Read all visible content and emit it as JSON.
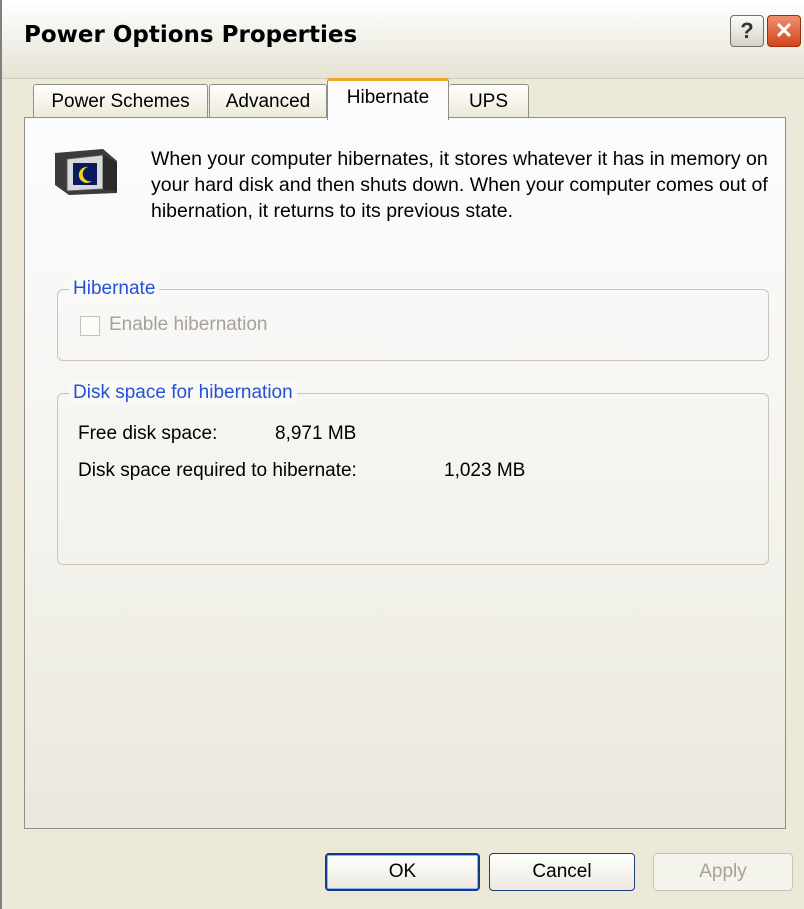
{
  "window": {
    "title": "Power Options Properties",
    "help_label": "?",
    "close_label": "✕"
  },
  "tabs": [
    {
      "label": "Power Schemes",
      "active": false
    },
    {
      "label": "Advanced",
      "active": false
    },
    {
      "label": "Hibernate",
      "active": true
    },
    {
      "label": "UPS",
      "active": false
    }
  ],
  "hibernate_tab": {
    "description": "When your computer hibernates, it stores whatever it has in memory on your hard disk and then shuts down. When your computer comes out of hibernation, it returns to its previous state.",
    "hibernate_group": {
      "legend": "Hibernate",
      "checkbox_label": "Enable hibernation",
      "checked": false,
      "enabled": false
    },
    "disk_group": {
      "legend": "Disk space for hibernation",
      "free_label": "Free disk space:",
      "free_value": "8,971 MB",
      "required_label": "Disk space required to hibernate:",
      "required_value": "1,023 MB"
    }
  },
  "buttons": {
    "ok": "OK",
    "cancel": "Cancel",
    "apply": "Apply"
  },
  "colors": {
    "dialog_bg": "#ece9d8",
    "active_tab_accent": "#f3a42b",
    "group_legend": "#2550d9",
    "close_button": "#d2461a"
  }
}
